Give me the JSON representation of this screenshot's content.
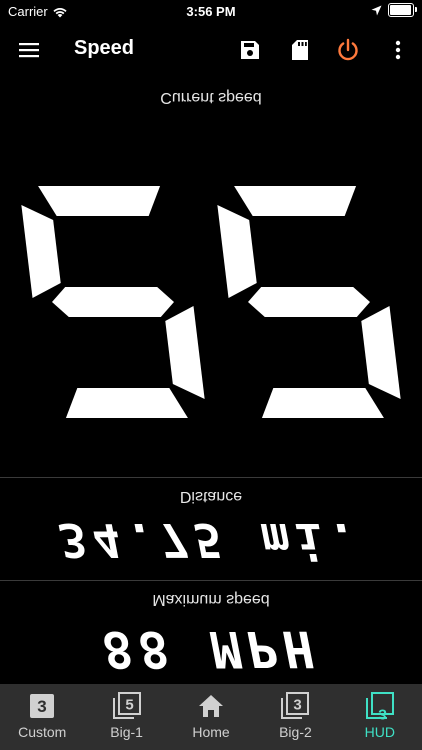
{
  "status_bar": {
    "carrier": "Carrier",
    "time": "3:56 PM",
    "battery_level": 0.95
  },
  "app_bar": {
    "title": "Speed",
    "icons": [
      "menu-icon",
      "save-icon",
      "sd-card-icon",
      "power-icon",
      "more-vert-icon"
    ],
    "power_color": "#ff7a3d"
  },
  "hud": {
    "current_label": "Current speed",
    "current_speed": "22",
    "distance_label": "Distance",
    "distance_value": "34.75 mi.",
    "max_label": "Maximum speed",
    "max_value": "88 MPH"
  },
  "tabs": [
    {
      "label": "Custom",
      "icon_digit": "3",
      "icon": "custom-icon",
      "active": false
    },
    {
      "label": "Big-1",
      "icon_digit": "5",
      "icon": "big-1-icon",
      "active": false
    },
    {
      "label": "Home",
      "icon": "home-icon",
      "active": false
    },
    {
      "label": "Big-2",
      "icon_digit": "3",
      "icon": "big-2-icon",
      "active": false
    },
    {
      "label": "HUD",
      "icon_digit": "3",
      "icon": "hud-icon",
      "active": true
    }
  ],
  "colors": {
    "background": "#000000",
    "tab_bar": "#2f2f2f",
    "active_tab": "#3fe0c5"
  }
}
